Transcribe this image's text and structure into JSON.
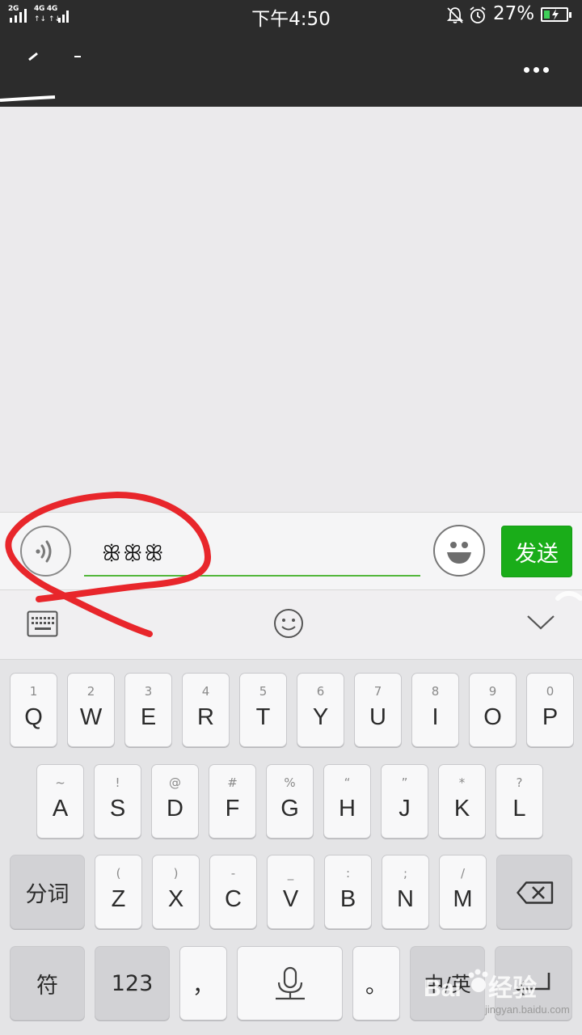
{
  "status_bar": {
    "sim1_network": "2G",
    "sim2_network": "4G 4G",
    "time": "下午4:50",
    "battery_percent": "27%",
    "battery_level": 0.27,
    "icons": [
      "signal-icon",
      "mute-bell-icon",
      "alarm-icon",
      "battery-charging-icon"
    ]
  },
  "title_bar": {
    "more_icon": "more-horizontal-icon"
  },
  "input_bar": {
    "voice_icon": "voice-icon",
    "input_value": "ꕥꕥꕥ",
    "emoji_icon": "emoji-icon",
    "send_label": "发送",
    "accent_color": "#1aad19"
  },
  "keyboard_toolbar": {
    "icons": [
      "keyboard-icon",
      "smiley-icon",
      "chevron-down-icon"
    ]
  },
  "keyboard": {
    "row1": [
      {
        "hint": "1",
        "key": "Q"
      },
      {
        "hint": "2",
        "key": "W"
      },
      {
        "hint": "3",
        "key": "E"
      },
      {
        "hint": "4",
        "key": "R"
      },
      {
        "hint": "5",
        "key": "T"
      },
      {
        "hint": "6",
        "key": "Y"
      },
      {
        "hint": "7",
        "key": "U"
      },
      {
        "hint": "8",
        "key": "I"
      },
      {
        "hint": "9",
        "key": "O"
      },
      {
        "hint": "0",
        "key": "P"
      }
    ],
    "row2": [
      {
        "hint": "~",
        "key": "A"
      },
      {
        "hint": "!",
        "key": "S"
      },
      {
        "hint": "@",
        "key": "D"
      },
      {
        "hint": "#",
        "key": "F"
      },
      {
        "hint": "%",
        "key": "G"
      },
      {
        "hint": "“",
        "key": "H"
      },
      {
        "hint": "”",
        "key": "J"
      },
      {
        "hint": "*",
        "key": "K"
      },
      {
        "hint": "?",
        "key": "L"
      }
    ],
    "row3": [
      {
        "hint": "(",
        "key": "Z"
      },
      {
        "hint": ")",
        "key": "X"
      },
      {
        "hint": "-",
        "key": "C"
      },
      {
        "hint": "_",
        "key": "V"
      },
      {
        "hint": ":",
        "key": "B"
      },
      {
        "hint": ";",
        "key": "N"
      },
      {
        "hint": "/",
        "key": "M"
      }
    ],
    "segment_label": "分词",
    "symbols_label": "符",
    "numbers_label": "123",
    "comma_label": "，",
    "period_label": "。",
    "lang_label": "中/英",
    "delete_icon": "backspace-icon",
    "mic_icon": "microphone-icon",
    "enter_icon": "enter-icon"
  },
  "watermark": {
    "text": "jingyan.baidu.com",
    "logo_text": "Baidu经验"
  },
  "annotation": {
    "color": "#e8262b",
    "description_icon": "red-circle-annotation"
  }
}
